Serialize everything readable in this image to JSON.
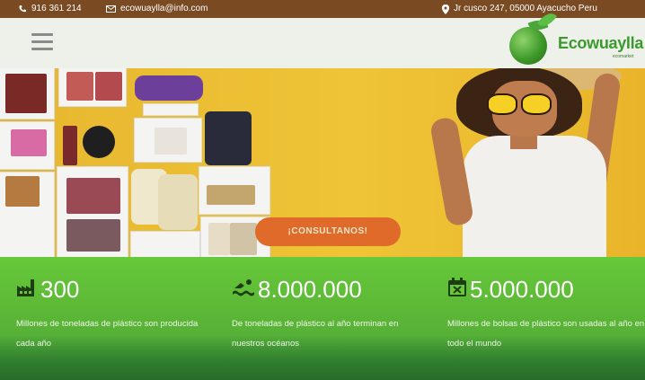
{
  "topbar": {
    "phone": "916 361 214",
    "email": "ecowuaylla@info.com",
    "address": "Jr cusco 247, 05000 Ayacucho Peru"
  },
  "header": {
    "logo_text": "Ecowuaylla",
    "logo_sub": "ecomarket",
    "menu_icon": "hamburger-menu-icon"
  },
  "hero": {
    "cta_label": "¡CONSULTANOS!"
  },
  "stats": [
    {
      "icon": "factory-icon",
      "value": "300",
      "text": "Millones de toneladas de plástico son producida cada año"
    },
    {
      "icon": "swimmer-wave-icon",
      "value": "8.000.000",
      "text": "De toneladas de plástico al año terminan en nuestros océanos"
    },
    {
      "icon": "calendar-x-icon",
      "value": "5.000.000",
      "text": "Millones de bolsas de plástico son usadas al año en todo el mundo"
    }
  ],
  "colors": {
    "topbar": "#7a4a22",
    "brand_green": "#3a9a2e",
    "cta": "#e06a2a",
    "hero_bg": "#efc436",
    "stats_bg": "#5cb736"
  }
}
